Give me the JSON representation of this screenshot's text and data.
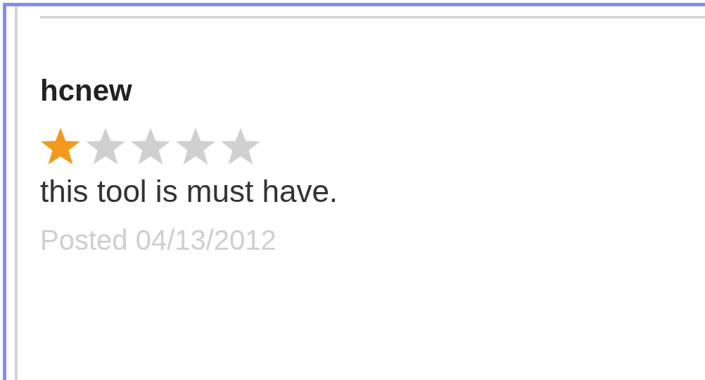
{
  "review": {
    "author": "hcnew",
    "stars": 1,
    "text": "this tool is must have.",
    "posted": "Posted 04/13/2012"
  }
}
